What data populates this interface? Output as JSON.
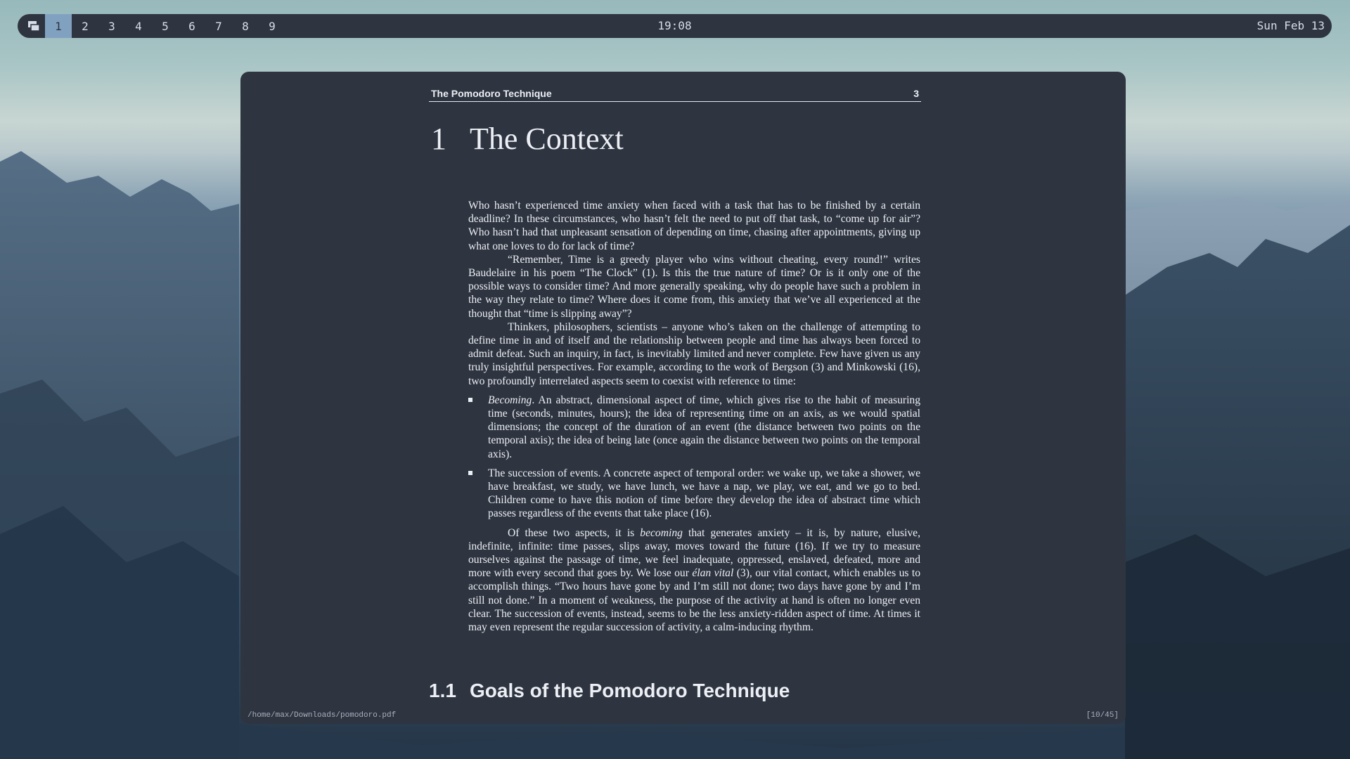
{
  "taskbar": {
    "workspaces": [
      "1",
      "2",
      "3",
      "4",
      "5",
      "6",
      "7",
      "8",
      "9"
    ],
    "active_workspace": "1",
    "clock": "19:08",
    "date": "Sun Feb 13"
  },
  "document": {
    "running_header": {
      "title": "The Pomodoro Technique",
      "page_number": "3"
    },
    "chapter": {
      "number": "1",
      "title": "The Context"
    },
    "paragraphs": {
      "p1": "Who hasn’t experienced time anxiety when faced with a task that has to be finished by a certain deadline? In these circumstances, who hasn’t felt the need to put off that task, to “come up for air”? Who hasn’t had that unpleasant sensation of depending on time, chasing after appointments, giving up what one loves to do for lack of time?",
      "p2": "“Remember, Time is a greedy player who wins without cheating, every round!” writes Baudelaire in his poem “The Clock” (1). Is this the true nature of time? Or is it only one of the possible ways to consider time? And more generally speaking, why do people have such a problem in the way they relate to time? Where does it come from, this anxiety that we’ve all experienced at the thought that “time is slipping away”?",
      "p3": "Thinkers, philosophers, scientists – anyone who’s taken on the challenge of attempting to define time in and of itself and the relationship between people and time has always been forced to admit defeat. Such an inquiry, in fact, is inevitably limited and never complete. Few have given us any truly insightful perspectives. For example, according to the work of Bergson (3) and Minkowski (16), two profoundly interrelated aspects seem to coexist with reference to time:"
    },
    "bullets": {
      "b1_term": "Becoming",
      "b1_text": ". An abstract, dimensional aspect of time, which gives rise to the habit of measuring time (seconds, minutes, hours); the idea of representing time on an axis, as we would spatial dimensions; the concept of the duration of an event (the distance between two points on the temporal axis); the idea of being late (once again the distance between two points on the temporal axis).",
      "b2_text": "The succession of events. A concrete aspect of temporal order: we wake up, we take a shower, we have breakfast, we study, we have lunch, we have a nap, we play, we eat, and we go to bed. Children come to have this notion of time before they develop the idea of abstract time which passes regardless of the events that take place (16)."
    },
    "p4": {
      "part1": "Of these two aspects, it is ",
      "em1": "becoming",
      "part2": " that generates anxiety – it is, by nature, elusive, indefinite, infinite: time passes, slips away, moves toward the future (16). If we try to measure ourselves against the passage of time, we feel inadequate, oppressed, enslaved, defeated, more and more with every second that goes by. We lose our ",
      "em2": "élan vital",
      "part3": " (3), our vital contact, which enables us to accomplish things. “Two hours have gone by and I’m still not done; two days have gone by and I’m still not done.” In a moment of weakness, the purpose of the activity at hand is often no longer even clear. The succession of events, instead, seems to be the less anxiety-ridden aspect of time. At times it may even represent the regular succession of activity, a calm-inducing rhythm."
    },
    "section": {
      "number": "1.1",
      "title": "Goals of the Pomodoro Technique"
    }
  },
  "statusbar": {
    "file_path": "/home/max/Downloads/pomodoro.pdf",
    "page_indicator": "[10/45]"
  },
  "colors": {
    "bar_bg": "#2e3440",
    "active_ws": "#81a1c1",
    "text": "#eceff4"
  },
  "icons": {
    "launcher": "window-stack-icon"
  }
}
